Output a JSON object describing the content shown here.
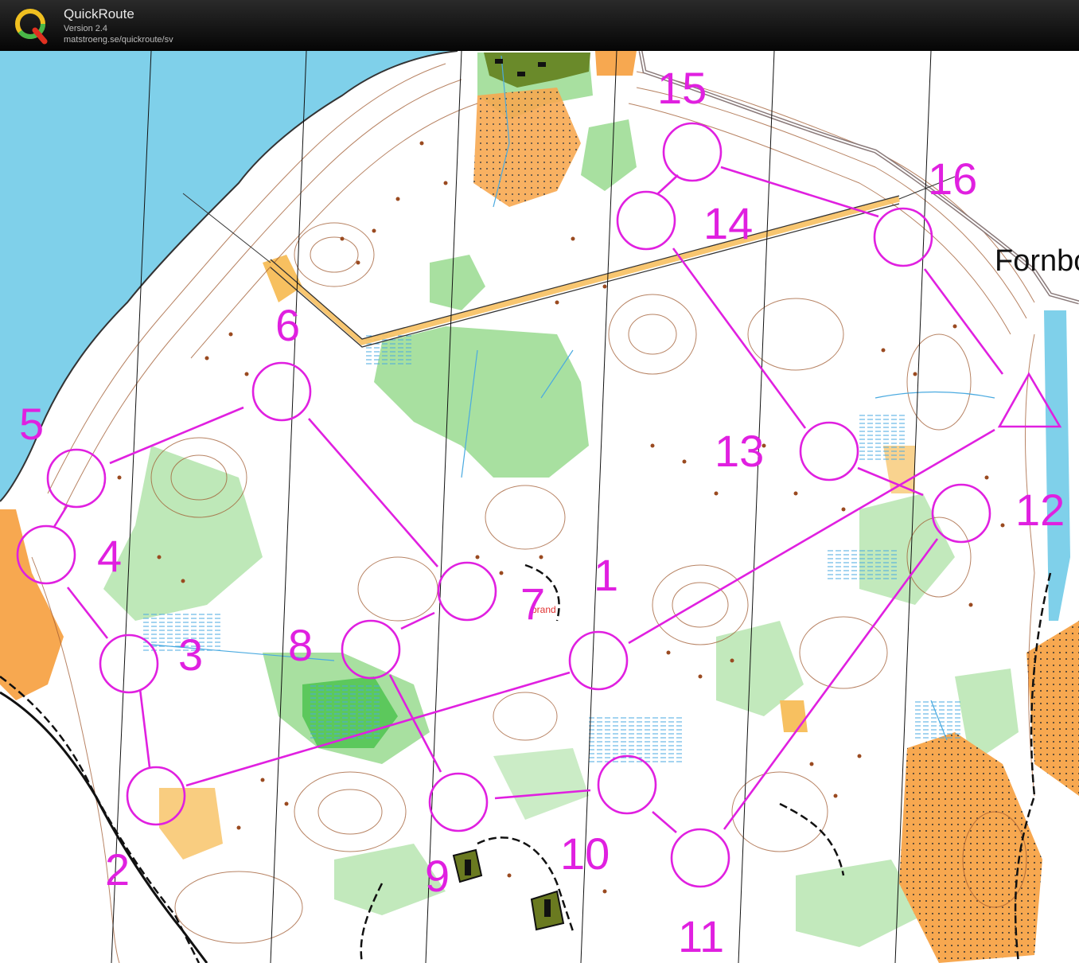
{
  "app": {
    "title": "QuickRoute",
    "version": "Version 2.4",
    "url": "matstroeng.se/quickroute/sv"
  },
  "map": {
    "place_label": "Fornbo",
    "small_label": "brand",
    "course_color": "#e020e0",
    "colors": {
      "water": "#7fd0ea",
      "open_land": "#f7c060",
      "dark_open": "#f0a040",
      "forest_green": "#a8e0a0",
      "dense_green": "#5cc85c",
      "contour": "#9a4a20",
      "road_grey": "#9a8a8a"
    },
    "start_label": "start-triangle",
    "controls": [
      {
        "number": "1"
      },
      {
        "number": "2"
      },
      {
        "number": "3"
      },
      {
        "number": "4"
      },
      {
        "number": "5"
      },
      {
        "number": "6"
      },
      {
        "number": "7"
      },
      {
        "number": "8"
      },
      {
        "number": "9"
      },
      {
        "number": "10"
      },
      {
        "number": "11"
      },
      {
        "number": "12"
      },
      {
        "number": "13"
      },
      {
        "number": "14"
      },
      {
        "number": "15"
      },
      {
        "number": "16"
      }
    ]
  }
}
